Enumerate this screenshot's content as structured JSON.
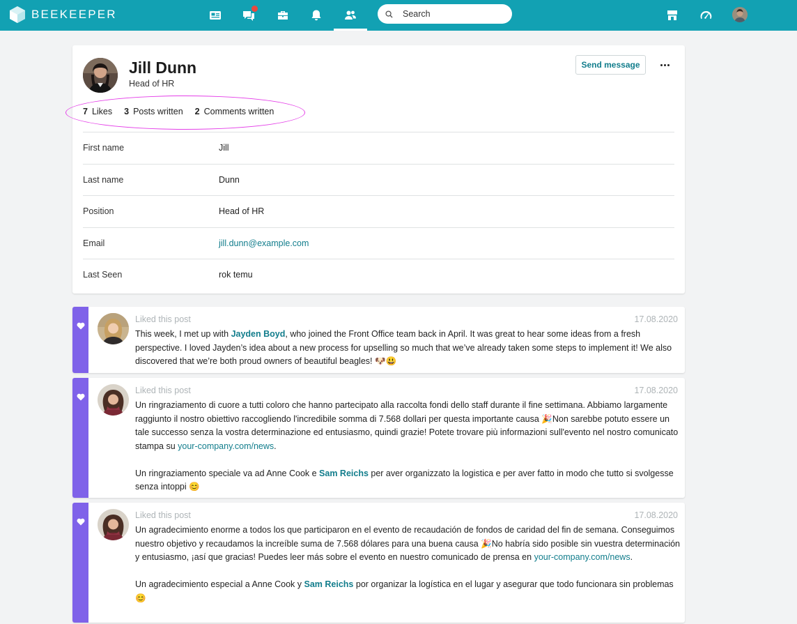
{
  "app": {
    "name": "BEEKEEPER"
  },
  "search": {
    "placeholder": "Search"
  },
  "profile": {
    "name": "Jill Dunn",
    "title": "Head of HR",
    "send_label": "Send message",
    "stats": [
      {
        "count": "7",
        "label": "Likes"
      },
      {
        "count": "3",
        "label": "Posts written"
      },
      {
        "count": "2",
        "label": "Comments written"
      }
    ],
    "fields": [
      {
        "label": "First name",
        "value": "Jill"
      },
      {
        "label": "Last name",
        "value": "Dunn"
      },
      {
        "label": "Position",
        "value": "Head of HR"
      },
      {
        "label": "Email",
        "value": "jill.dunn@example.com"
      },
      {
        "label": "Last Seen",
        "value": "rok temu"
      }
    ]
  },
  "posts": [
    {
      "meta": "Liked this post",
      "date": "17.08.2020",
      "p1_a": "This week, I met up with ",
      "p1_mention": "Jayden Boyd",
      "p1_b": ", who joined the Front Office team back in April. It was great to hear some ideas from a fresh perspective. I loved Jayden’s idea about a new process for upselling so much that we’ve already taken some steps to implement it! We also discovered that we’re both proud owners of beautiful beagles! 🐶😃"
    },
    {
      "meta": "Liked this post",
      "date": "17.08.2020",
      "p1_a": "Un ringraziamento di cuore a tutti coloro che hanno partecipato alla raccolta fondi dello staff durante il fine settimana. Abbiamo largamente raggiunto il nostro obiettivo raccogliendo l'incredibile somma di 7.568 dollari per questa importante causa 🎉Non sarebbe potuto essere un tale successo senza la vostra determinazione ed entusiasmo, quindi grazie! Potete trovare più informazioni sull'evento nel nostro comunicato stampa su ",
      "p1_url": "your-company.com/news",
      "p1_b": ".",
      "p2_a": "Un ringraziamento speciale va ad Anne Cook e ",
      "p2_mention": "Sam Reichs",
      "p2_b": " per aver organizzato la logistica e per aver fatto in modo che tutto si svolgesse senza intoppi 😊"
    },
    {
      "meta": "Liked this post",
      "date": "17.08.2020",
      "p1_a": "Un agradecimiento enorme a todos los que participaron en el evento de recaudación de fondos de caridad del fin de semana. Conseguimos nuestro objetivo y recaudamos la increíble suma de 7.568 dólares para una buena causa 🎉No habría sido posible sin vuestra determinación y entusiasmo, ¡así que gracias! Puedes leer más sobre el evento en nuestro comunicado de prensa en ",
      "p1_url": "your-company.com/news",
      "p1_b": ".",
      "p2_a": "Un agradecimiento especial a Anne Cook y ",
      "p2_mention": "Sam Reichs",
      "p2_b": " por organizar la logística en el lugar y asegurar que todo funcionara sin problemas 😊"
    }
  ]
}
